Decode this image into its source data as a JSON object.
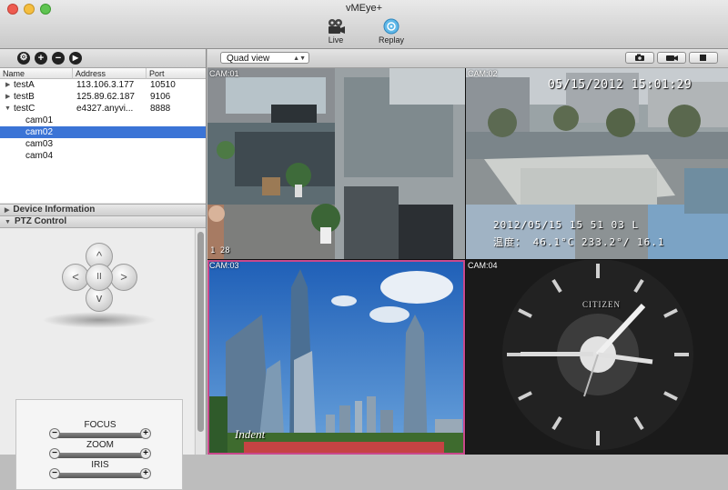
{
  "window": {
    "title": "vMEye+"
  },
  "toolbar": {
    "live_label": "Live",
    "replay_label": "Replay"
  },
  "sidebar": {
    "buttons": {
      "settings": "⚙",
      "add": "+",
      "remove": "−",
      "play": "▶"
    },
    "columns": {
      "name": "Name",
      "address": "Address",
      "port": "Port"
    },
    "devices": [
      {
        "name": "testA",
        "address": "113.106.3.177",
        "port": "10510",
        "expander": "▶"
      },
      {
        "name": "testB",
        "address": "125.89.62.187",
        "port": "9106",
        "expander": "▶"
      },
      {
        "name": "testC",
        "address": "e4327.anyvi...",
        "port": "8888",
        "expander": "▼"
      }
    ],
    "cameras": [
      "cam01",
      "cam02",
      "cam03",
      "cam04"
    ],
    "selected_camera": "cam02",
    "sections": {
      "device_info": "Device Information",
      "ptz": "PTZ Control"
    },
    "section_arrows": {
      "collapsed": "▶",
      "expanded": "▼"
    }
  },
  "ptz": {
    "up": "^",
    "down": "v",
    "left": "<",
    "right": ">",
    "center": "II",
    "focus_label": "FOCUS",
    "zoom_label": "ZOOM",
    "iris_label": "IRIS",
    "minus": "−",
    "plus": "+"
  },
  "view": {
    "selected": "Quad view",
    "dropdown": "▲▼"
  },
  "cameras": [
    {
      "label": "CAM:01",
      "osd_corner": "1 28"
    },
    {
      "label": "CAM:02",
      "osd_datetime": "05/15/2012 15:01:29",
      "osd_line1": "2012/05/15 15 51 03 L",
      "osd_line2": "温度： 46.1°C  233.2°/ 16.1"
    },
    {
      "label": "CAM:03",
      "watermark": "Indent"
    },
    {
      "label": "CAM:04",
      "brand": "CITIZEN"
    }
  ],
  "colors": {
    "selection": "#3b74d6",
    "cam_selected_border": "#c9488c"
  }
}
